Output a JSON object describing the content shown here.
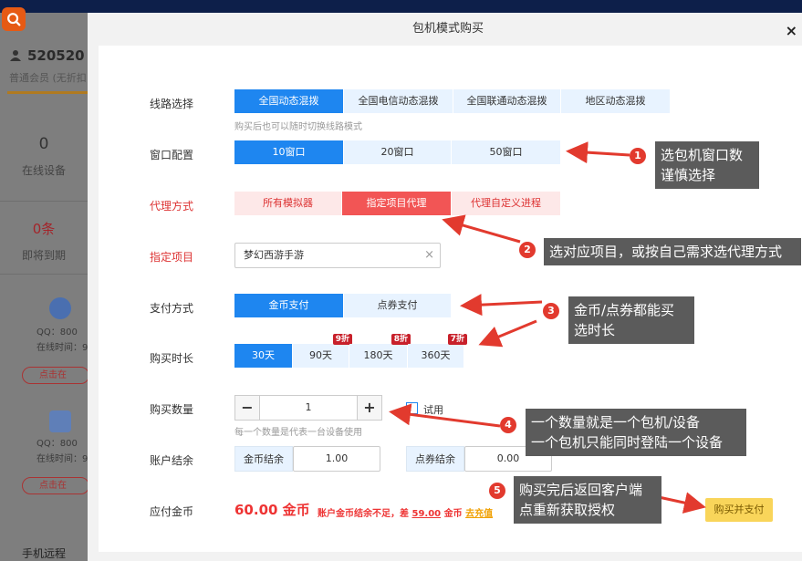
{
  "background": {
    "user_id": "520520",
    "user_level": "普通会员 (无折扣",
    "stats": [
      {
        "value": "0",
        "label": "在线设备"
      },
      {
        "value": "0条",
        "label": "即将到期"
      }
    ],
    "devices": [
      {
        "qq": "QQ：800",
        "online": "在线时间：9",
        "button": "点击在"
      },
      {
        "qq": "QQ：800",
        "online": "在线时间：9",
        "button": "点击在"
      }
    ],
    "bottom_label": "手机远程"
  },
  "modal": {
    "title": "包机模式购买",
    "close": "×",
    "line": {
      "label": "线路选择",
      "options": [
        "全国动态混拨",
        "全国电信动态混拨",
        "全国联通动态混拨",
        "地区动态混拨"
      ],
      "selected": "全国动态混拨",
      "hint": "购买后也可以随时切换线路模式"
    },
    "window": {
      "label": "窗口配置",
      "options": [
        "10窗口",
        "20窗口",
        "50窗口"
      ],
      "selected": "10窗口"
    },
    "proxy": {
      "label": "代理方式",
      "options": [
        "所有模拟器",
        "指定项目代理",
        "代理自定义进程"
      ],
      "selected": "指定项目代理"
    },
    "project": {
      "label": "指定项目",
      "value": "梦幻西游手游",
      "clear": "×"
    },
    "payment": {
      "label": "支付方式",
      "options": [
        "金币支付",
        "点券支付"
      ],
      "selected": "金币支付"
    },
    "duration": {
      "label": "购买时长",
      "options": [
        {
          "text": "30天",
          "badge": ""
        },
        {
          "text": "90天",
          "badge": "9折"
        },
        {
          "text": "180天",
          "badge": "8折"
        },
        {
          "text": "360天",
          "badge": "7折"
        }
      ],
      "selected": "30天"
    },
    "quantity": {
      "label": "购买数量",
      "minus": "−",
      "value": "1",
      "plus": "+",
      "trial_label": "试用",
      "hint": "每一个数量是代表一台设备使用"
    },
    "balance": {
      "label": "账户结余",
      "gold_label": "金币结余",
      "gold_value": "1.00",
      "coupon_label": "点券结余",
      "coupon_value": "0.00"
    },
    "total": {
      "label": "应付金币",
      "amount": "60.00 金币",
      "warn_prefix": "账户金币结余不足，差",
      "warn_amount": "59.00",
      "warn_unit": "金币",
      "warn_link": "去充值"
    },
    "pay_button": "购买并支付"
  },
  "annotations": [
    {
      "num": "1",
      "text": "选包机窗口数\n谨慎选择"
    },
    {
      "num": "2",
      "text": "选对应项目，或按自己需求选代理方式"
    },
    {
      "num": "3",
      "text": "金币/点券都能买\n选时长"
    },
    {
      "num": "4",
      "text": "一个数量就是一个包机/设备\n一个包机只能同时登陆一个设备"
    },
    {
      "num": "5",
      "text": "购买完后返回客户端\n点重新获取授权"
    }
  ],
  "colors": {
    "primary": "#1e86f0",
    "primary_light": "#e8f3ff",
    "danger": "#f25555",
    "danger_light": "#fde8e8",
    "price": "#e33333",
    "pay_button": "#f9d55a",
    "annotation_bg": "#5b5b5b",
    "annotation_num": "#e23a2e"
  }
}
